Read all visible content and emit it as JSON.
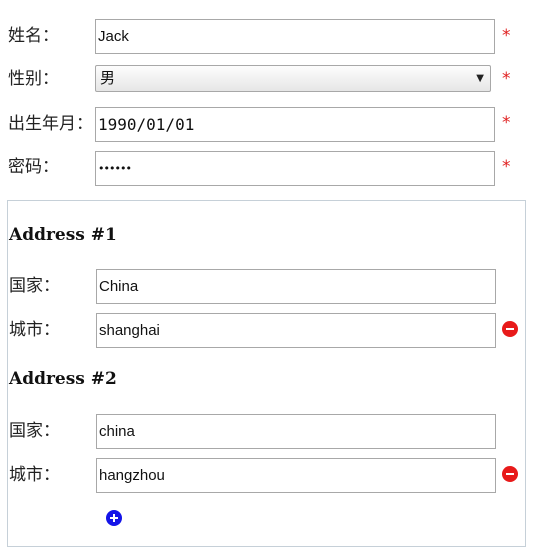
{
  "form": {
    "name": {
      "label": "姓名：",
      "value": "Jack",
      "required_mark": "*"
    },
    "gender": {
      "label": "性别：",
      "selected": "男",
      "required_mark": "*"
    },
    "birth": {
      "label": "出生年月：",
      "value": "1990/01/01",
      "required_mark": "*"
    },
    "password": {
      "label": "密码：",
      "value": "••••••",
      "required_mark": "*"
    }
  },
  "addresses": [
    {
      "heading": "Address #1",
      "country_label": "国家：",
      "country_value": "China",
      "city_label": "城市：",
      "city_value": "shanghai"
    },
    {
      "heading": "Address #2",
      "country_label": "国家：",
      "country_value": "china",
      "city_label": "城市：",
      "city_value": "hangzhou"
    }
  ],
  "colors": {
    "required": "#e02020",
    "remove_button": "#e81a1a",
    "add_button": "#1414e8"
  },
  "icons": {
    "remove": "minus-circle-icon",
    "add": "plus-circle-icon",
    "select_arrow": "triangle-down-icon"
  }
}
